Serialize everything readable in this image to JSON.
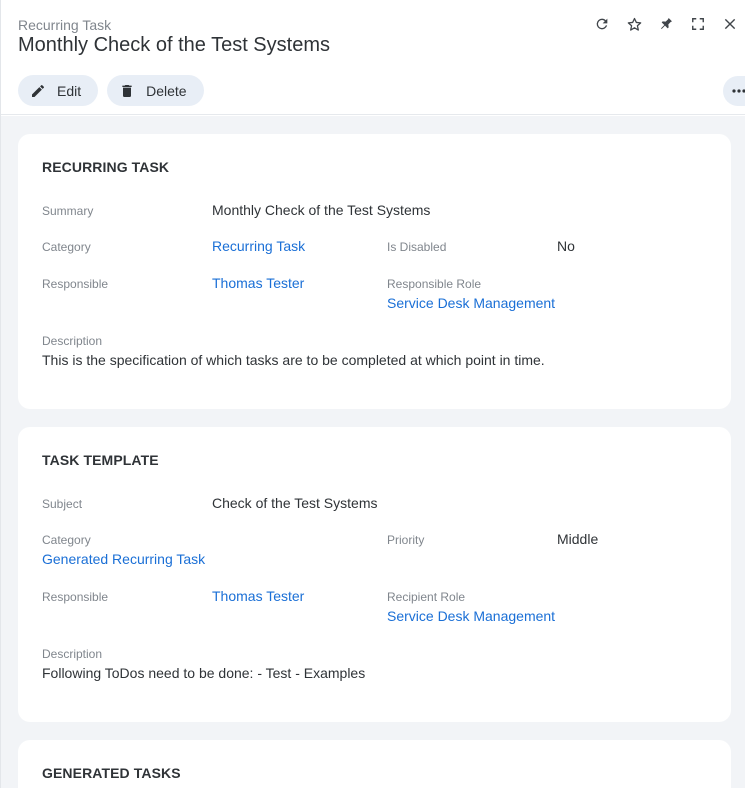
{
  "header": {
    "breadcrumb": "Recurring Task",
    "title": "Monthly Check of the Test Systems",
    "icons": [
      "refresh-icon",
      "star-icon",
      "pin-icon",
      "expand-icon",
      "close-icon"
    ]
  },
  "actions": {
    "edit_label": "Edit",
    "delete_label": "Delete"
  },
  "recurring_task": {
    "section_title": "RECURRING TASK",
    "summary_label": "Summary",
    "summary_value": "Monthly Check of the Test Systems",
    "category_label": "Category",
    "category_value": "Recurring Task",
    "is_disabled_label": "Is Disabled",
    "is_disabled_value": "No",
    "responsible_label": "Responsible",
    "responsible_value": "Thomas Tester",
    "responsible_role_label": "Responsible Role",
    "responsible_role_value": "Service Desk Management",
    "description_label": "Description",
    "description_value": "This is the specification of which tasks are to be completed at which point in time."
  },
  "task_template": {
    "section_title": "TASK TEMPLATE",
    "subject_label": "Subject",
    "subject_value": "Check of the Test Systems",
    "category_label": "Category",
    "category_value": "Generated Recurring Task",
    "priority_label": "Priority",
    "priority_value": "Middle",
    "responsible_label": "Responsible",
    "responsible_value": "Thomas Tester",
    "recipient_role_label": "Recipient Role",
    "recipient_role_value": "Service Desk Management",
    "description_label": "Description",
    "description_value": "Following ToDos need to be done: - Test - Examples"
  },
  "generated_tasks": {
    "section_title": "GENERATED TASKS"
  },
  "colors": {
    "link": "#1a6fd6",
    "button_bg": "#e8eef6",
    "content_bg": "#f2f4f7",
    "label": "#80868d",
    "text": "#2f3337"
  }
}
